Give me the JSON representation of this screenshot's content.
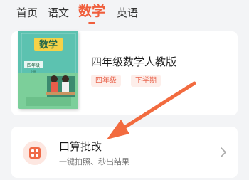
{
  "tabs": [
    {
      "label": "首页",
      "active": false
    },
    {
      "label": "语文",
      "active": false
    },
    {
      "label": "数学",
      "active": true
    },
    {
      "label": "英语",
      "active": false
    }
  ],
  "book": {
    "title": "四年级数学人教版",
    "tags": [
      "四年级",
      "下学期"
    ],
    "cover": {
      "subject": "数学",
      "grade": "四年级",
      "volume": "上册"
    }
  },
  "tool": {
    "title": "口算批改",
    "subtitle": "一键拍照、秒出结果",
    "icon": "calculator-icon"
  },
  "colors": {
    "accent": "#f05e3c",
    "tag_bg": "#fdeeea",
    "arrow": "#f26b3f"
  }
}
